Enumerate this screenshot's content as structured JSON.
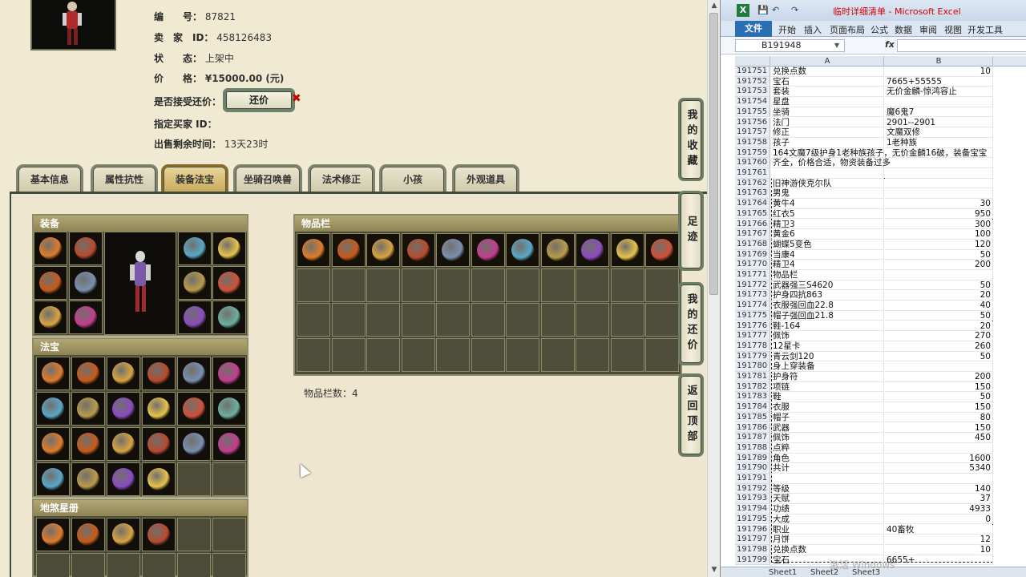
{
  "item": {
    "number_label": "编　　号：",
    "number": "87821",
    "seller_label": "卖　家　ID：",
    "seller_id": "458126483",
    "status_label": "状　　态：",
    "status": "上架中",
    "price_label": "价　　格：",
    "price": "¥15000.00 (元)",
    "accept_bargain_label": "是否接受还价：",
    "bargain_button": "还价",
    "designated_buyer_label": "指定买家 ID：",
    "remaining_label": "出售剩余时间：",
    "remaining": "13天23时"
  },
  "tabs": [
    {
      "label": "基本信息",
      "active": false
    },
    {
      "label": "属性抗性",
      "active": false
    },
    {
      "label": "装备法宝",
      "active": true
    },
    {
      "label": "坐骑召唤兽",
      "active": false
    },
    {
      "label": "法术修正",
      "active": false
    },
    {
      "label": "小孩",
      "active": false
    },
    {
      "label": "外观道具",
      "active": false
    }
  ],
  "sections": {
    "equipment": "装备",
    "treasure": "法宝",
    "stars": "地煞星册",
    "inventory": "物品栏",
    "inventory_count": "物品栏数：4"
  },
  "side_buttons": [
    {
      "label": "我的收藏"
    },
    {
      "label": "足迹"
    },
    {
      "label": "我的还价"
    },
    {
      "label": "返回顶部"
    }
  ],
  "icon_colors": [
    "#e07b2a",
    "#c95a1a",
    "#d9a441",
    "#b84a2e",
    "#7a8fb0",
    "#c43c8e",
    "#58a8c8",
    "#b99b4a",
    "#8a4bc2",
    "#e7c34a",
    "#d0503a",
    "#6bb0a0"
  ],
  "excel": {
    "title": "临时详细清单 - Microsoft Excel",
    "quick_access": [
      "💾",
      "↶",
      "↷"
    ],
    "file_tab": "文件",
    "ribbon_tabs": [
      "开始",
      "插入",
      "页面布局",
      "公式",
      "数据",
      "审阅",
      "视图",
      "开发工具"
    ],
    "namebox": "B191948",
    "fx": "fx",
    "col_a": "A",
    "col_b": "B",
    "rows": [
      {
        "n": "191751",
        "a": "兑换点数",
        "b": "10",
        "num": true
      },
      {
        "n": "191752",
        "a": "宝石",
        "b": "7665+55555",
        "num": false
      },
      {
        "n": "191753",
        "a": "套装",
        "b": "无价金麟-惊鸿容止",
        "num": false
      },
      {
        "n": "191754",
        "a": "星盘",
        "b": "",
        "num": false
      },
      {
        "n": "191755",
        "a": "坐骑",
        "b": "魔6鬼7",
        "num": false
      },
      {
        "n": "191756",
        "a": "法门",
        "b": "2901--2901",
        "num": false
      },
      {
        "n": "191757",
        "a": "修正",
        "b": "文魔双修",
        "num": false
      },
      {
        "n": "191758",
        "a": "孩子",
        "b": "1老种族",
        "num": false
      },
      {
        "n": "191759",
        "a": "164文魔7级护身1老种族孩子，无价金麟16破，装备宝宝",
        "b": "",
        "num": false
      },
      {
        "n": "191760",
        "a": "齐全，价格合适，物资装备过多",
        "b": "",
        "num": false
      },
      {
        "n": "191761",
        "a": "",
        "b": "",
        "num": false
      },
      {
        "n": "191762",
        "a": "旧神游侠克尔队",
        "b": "",
        "num": false
      },
      {
        "n": "191763",
        "a": "男鬼",
        "b": "",
        "num": false
      },
      {
        "n": "191764",
        "a": "黄牛4",
        "b": "30",
        "num": true
      },
      {
        "n": "191765",
        "a": "红衣5",
        "b": "950",
        "num": true
      },
      {
        "n": "191766",
        "a": "精卫3",
        "b": "300",
        "num": true
      },
      {
        "n": "191767",
        "a": "黄金6",
        "b": "100",
        "num": true
      },
      {
        "n": "191768",
        "a": "蝴蝶5变色",
        "b": "120",
        "num": true
      },
      {
        "n": "191769",
        "a": "当康4",
        "b": "50",
        "num": true
      },
      {
        "n": "191770",
        "a": "精卫4",
        "b": "200",
        "num": true
      },
      {
        "n": "191771",
        "a": "物品栏",
        "b": "",
        "num": false
      },
      {
        "n": "191772",
        "a": "武器强三S4620",
        "b": "50",
        "num": true
      },
      {
        "n": "191773",
        "a": "护身四抗863",
        "b": "20",
        "num": true
      },
      {
        "n": "191774",
        "a": "衣服强回血22.8",
        "b": "40",
        "num": true
      },
      {
        "n": "191775",
        "a": "帽子强回血21.8",
        "b": "50",
        "num": true
      },
      {
        "n": "191776",
        "a": "鞋-164",
        "b": "20",
        "num": true
      },
      {
        "n": "191777",
        "a": "佩饰",
        "b": "270",
        "num": true
      },
      {
        "n": "191778",
        "a": "12星卡",
        "b": "260",
        "num": true
      },
      {
        "n": "191779",
        "a": "青云剑120",
        "b": "50",
        "num": true
      },
      {
        "n": "191780",
        "a": "身上穿装备",
        "b": "",
        "num": false
      },
      {
        "n": "191781",
        "a": "护身符",
        "b": "200",
        "num": true
      },
      {
        "n": "191782",
        "a": "项链",
        "b": "150",
        "num": true
      },
      {
        "n": "191783",
        "a": "鞋",
        "b": "50",
        "num": true
      },
      {
        "n": "191784",
        "a": "衣服",
        "b": "150",
        "num": true
      },
      {
        "n": "191785",
        "a": "帽子",
        "b": "80",
        "num": true
      },
      {
        "n": "191786",
        "a": "武器",
        "b": "150",
        "num": true
      },
      {
        "n": "191787",
        "a": "佩饰",
        "b": "450",
        "num": true
      },
      {
        "n": "191788",
        "a": "点粹",
        "b": "",
        "num": false
      },
      {
        "n": "191789",
        "a": "角色",
        "b": "1600",
        "num": true
      },
      {
        "n": "191790",
        "a": "共计",
        "b": "5340",
        "num": true
      },
      {
        "n": "191791",
        "a": "",
        "b": "",
        "num": false
      },
      {
        "n": "191792",
        "a": "等级",
        "b": "140",
        "num": true
      },
      {
        "n": "191793",
        "a": "天赋",
        "b": "37",
        "num": true
      },
      {
        "n": "191794",
        "a": "功绩",
        "b": "4933",
        "num": true
      },
      {
        "n": "191795",
        "a": "大成",
        "b": "0",
        "num": true
      },
      {
        "n": "191796",
        "a": "职业",
        "b": "40畜牧",
        "num": false
      },
      {
        "n": "191797",
        "a": "月饼",
        "b": "12",
        "num": true
      },
      {
        "n": "191798",
        "a": "兑换点数",
        "b": "10",
        "num": true
      },
      {
        "n": "191799",
        "a": "宝石",
        "b": "6655+",
        "num": false
      }
    ],
    "sheets": [
      "Sheet1",
      "Sheet2",
      "Sheet3"
    ],
    "watermark": "激活 Windows"
  }
}
